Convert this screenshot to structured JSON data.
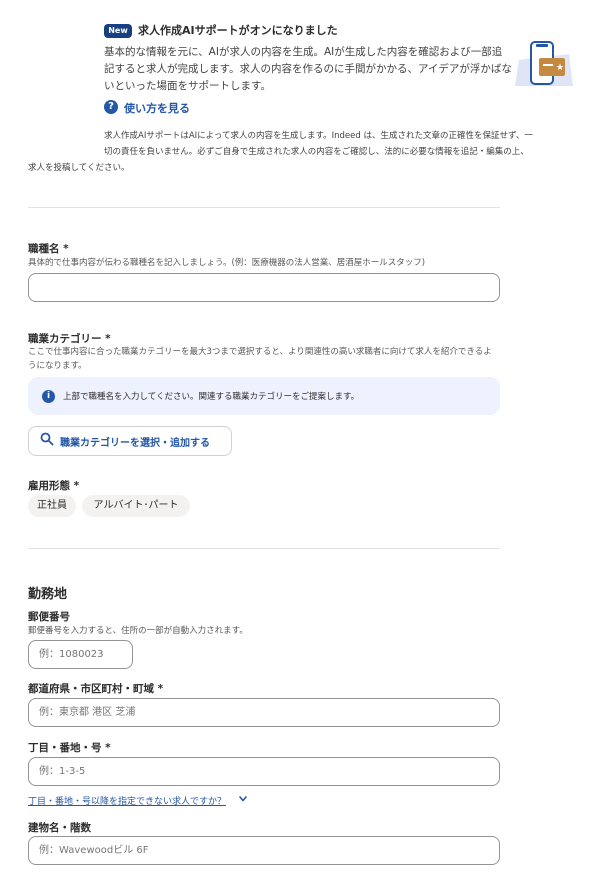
{
  "banner": {
    "badge": "New",
    "title": "求人作成AIサポートがオンになりました",
    "body": "基本的な情報を元に、AIが求人の内容を生成。AIが生成した内容を確認および一部追記すると求人が完成します。求人の内容を作るのに手間がかかる、アイデアが浮かばないといった場面をサポートします。",
    "help_link": "使い方を見る",
    "disclaimer_line1": "求人作成AIサポートはAIによって求人の内容を生成します。Indeed は、生成された文章の正確性を保証せず、一",
    "disclaimer_line2": "切の責任を負いません。必ずご自身で生成された求人の内容をご確認し、法的に必要な情報を追記・編集の上、",
    "disclaimer_line3": "求人を投稿してください。"
  },
  "job_title": {
    "label": "職種名 *",
    "hint": "具体的で仕事内容が伝わる職種名を記入しましょう。(例：医療機器の法人営業、居酒屋ホールスタッフ)",
    "value": "",
    "placeholder": ""
  },
  "job_category": {
    "label": "職業カテゴリー *",
    "hint": "ここで仕事内容に合った職業カテゴリーを最大3つまで選択すると、より関連性の高い求職者に向けて求人を紹介できるようになります。",
    "info": "上部で職種名を入力してください。関連する職業カテゴリーをご提案します。",
    "button": "職業カテゴリーを選択・追加する"
  },
  "employment_type": {
    "label": "雇用形態 *",
    "options": [
      "正社員",
      "アルバイト･パート"
    ]
  },
  "location": {
    "section_title": "勤務地",
    "postal": {
      "label": "郵便番号",
      "hint": "郵便番号を入力すると、住所の一部が自動入力されます。",
      "placeholder": "例：1080023"
    },
    "city": {
      "label": "都道府県・市区町村・町域 *",
      "placeholder": "例：東京都 港区 芝浦"
    },
    "street": {
      "label": "丁目・番地・号 *",
      "placeholder": "例：1-3-5",
      "help_link": "丁目・番地・号以降を指定できない求人ですか？"
    },
    "building": {
      "label": "建物名・階数",
      "placeholder": "例：Wavewoodビル 6F"
    }
  },
  "colors": {
    "accent": "#2557a7",
    "badge": "#164081",
    "info_bg": "#eef1fe",
    "chip_bg": "#f3f2f1"
  }
}
